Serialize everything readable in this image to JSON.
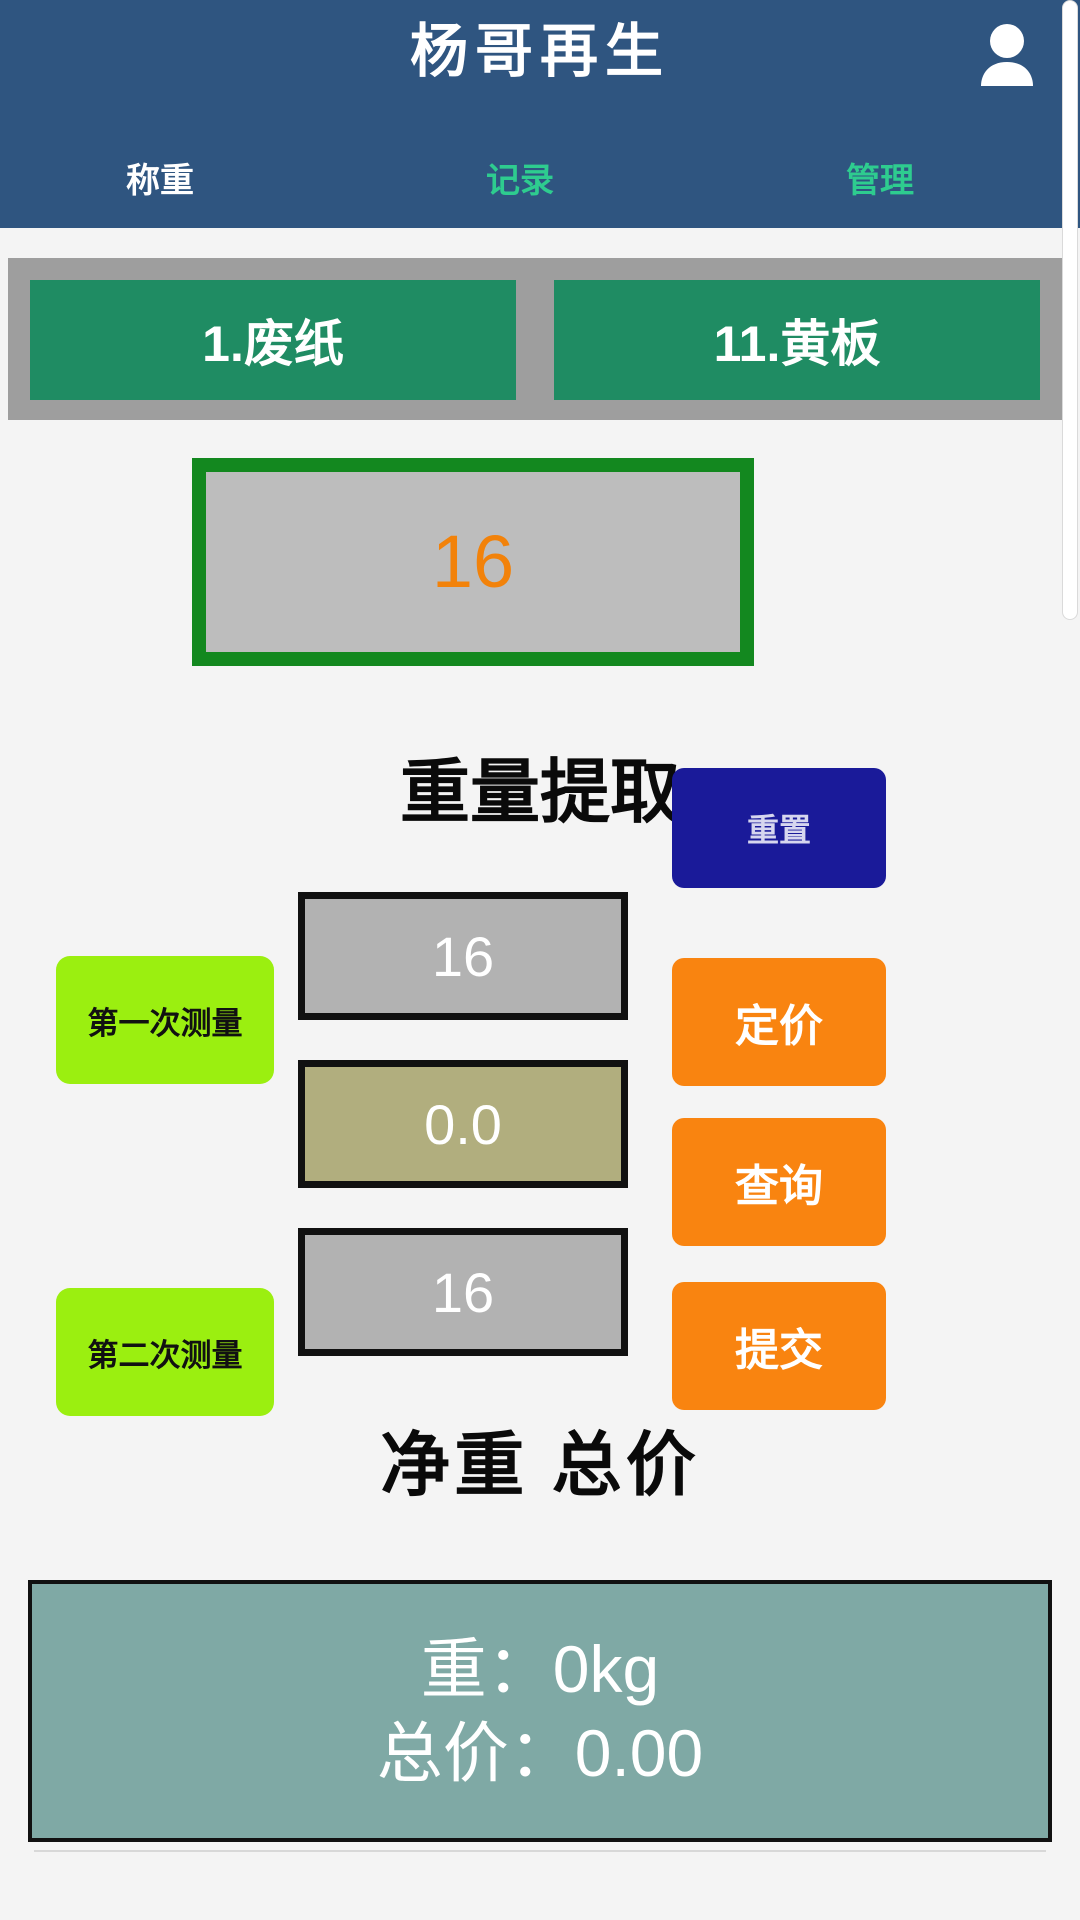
{
  "header": {
    "app_title": "杨哥再生",
    "account_icon": "person-icon",
    "brand_color": "#2f5580",
    "tabs": [
      {
        "label": "称重",
        "active": true,
        "color": "#ffffff"
      },
      {
        "label": "记录",
        "active": false,
        "color": "#2ecc8f"
      },
      {
        "label": "管理",
        "active": false,
        "color": "#2ecc8f"
      }
    ]
  },
  "categories": {
    "strip_color": "#9e9e9e",
    "button_color": "#1f8c63",
    "items": [
      {
        "label": "1.废纸"
      },
      {
        "label": "11.黄板"
      }
    ]
  },
  "live_weight": {
    "value": "16",
    "value_color": "#f2820a",
    "border_color": "#13881f",
    "background_color": "#bdbdbd"
  },
  "extraction": {
    "heading": "重量提取",
    "reset_label": "重置",
    "reset_color": "#1a1a99",
    "rows": [
      {
        "label": "第一次测量",
        "value": "16",
        "field_color": "#b2b2b2"
      },
      {
        "label": "",
        "value": "0.0",
        "field_color": "#b1ae7e"
      },
      {
        "label": "第二次测量",
        "value": "16",
        "field_color": "#b2b2b2"
      }
    ],
    "actions": [
      {
        "label": "定价"
      },
      {
        "label": "查询"
      },
      {
        "label": "提交"
      }
    ],
    "action_color": "#f98410",
    "label_color": "#9bef10"
  },
  "totals": {
    "heading": "净重 总价",
    "panel_color": "#7fa9a5",
    "weight_line": "重：0kg",
    "price_line": "总价：0.00"
  }
}
